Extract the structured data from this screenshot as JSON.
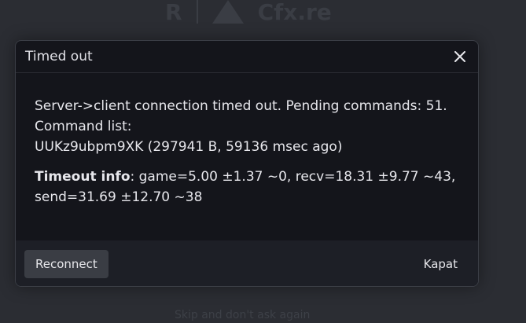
{
  "background": {
    "brand_cfx": "Cfx.re",
    "rockstar_mark": "R",
    "skip_text": "Skip and don't ask again"
  },
  "dialog": {
    "title": "Timed out",
    "close_icon": "close-icon",
    "message_line1": "Server->client connection timed out. Pending commands: 51.",
    "message_line2": "Command list:",
    "message_line3": "UUKz9ubpm9XK (297941 B, 59136 msec ago)",
    "timeout_label": "Timeout info",
    "timeout_line1": ": game=5.00 ±1.37 ~0, recv=18.31 ±9.77 ~43,",
    "timeout_line2": "send=31.69 ±12.70 ~38",
    "reconnect_label": "Reconnect",
    "close_label": "Kapat"
  },
  "colors": {
    "page_bg": "#2b2d33",
    "modal_bg": "#14151b",
    "footer_bg": "#1d1f26",
    "button_bg": "#3a3d44",
    "text": "#e7e7ec"
  }
}
